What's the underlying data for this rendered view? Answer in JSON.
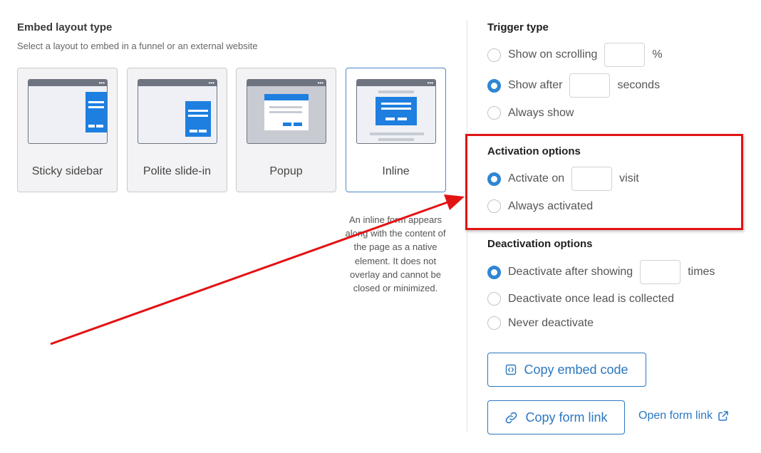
{
  "embed": {
    "title": "Embed layout type",
    "subtitle": "Select a layout to embed in a funnel or an external website",
    "layouts": [
      {
        "label": "Sticky sidebar",
        "selected": false
      },
      {
        "label": "Polite slide-in",
        "selected": false
      },
      {
        "label": "Popup",
        "selected": false
      },
      {
        "label": "Inline",
        "selected": true
      }
    ],
    "description": "An inline form appears along with the content of the page as a native element. It does not overlay and cannot be closed or minimized."
  },
  "trigger": {
    "title": "Trigger type",
    "options": [
      {
        "label": "Show on scrolling",
        "suffix": "%",
        "selected": false
      },
      {
        "label": "Show after",
        "suffix": "seconds",
        "selected": true
      },
      {
        "label": "Always show",
        "selected": false
      }
    ]
  },
  "activation": {
    "title": "Activation options",
    "options": [
      {
        "label": "Activate on",
        "suffix": "visit",
        "selected": true
      },
      {
        "label": "Always activated",
        "selected": false
      }
    ]
  },
  "deactivation": {
    "title": "Deactivation options",
    "options": [
      {
        "label": "Deactivate after showing",
        "suffix": "times",
        "selected": true
      },
      {
        "label": "Deactivate once lead is collected",
        "selected": false
      },
      {
        "label": "Never deactivate",
        "selected": false
      }
    ]
  },
  "actions": {
    "copy_embed_code": "Copy embed code",
    "copy_form_link": "Copy form link",
    "open_form_link": "Open form link"
  },
  "annotation": {
    "color": "#e21313"
  },
  "colors": {
    "accent": "#2b78c2",
    "radio_selected": "#2f86d3",
    "preview_blue": "#1e7fe0"
  }
}
